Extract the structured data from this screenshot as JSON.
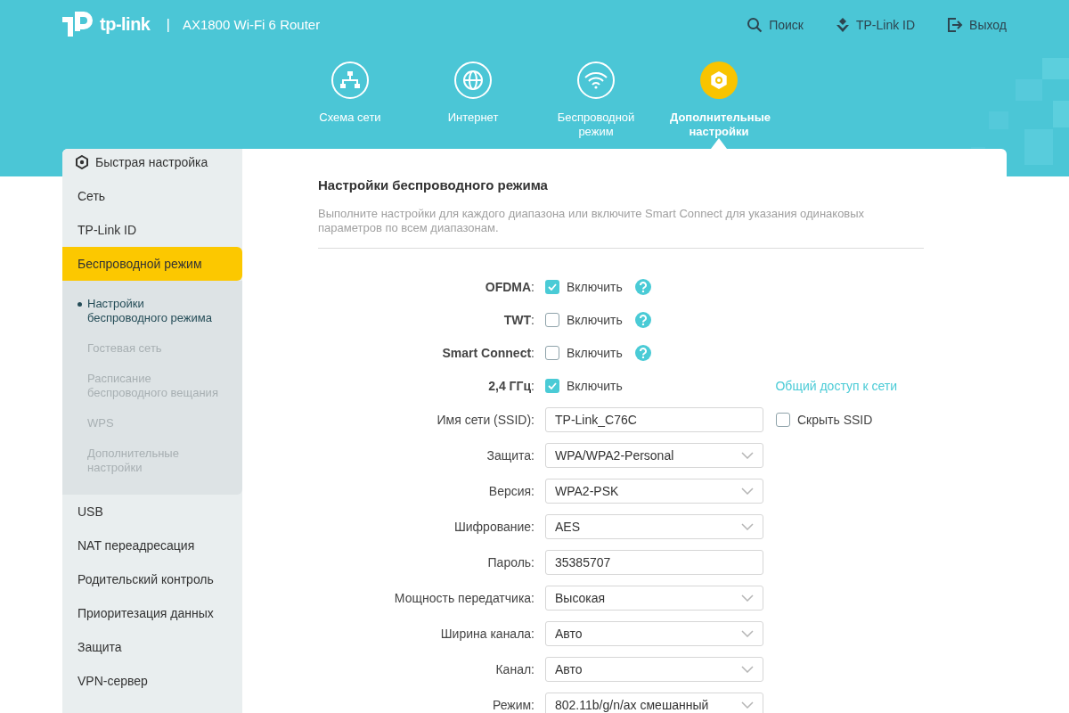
{
  "header": {
    "brand": "tp-link",
    "model": "AX1800 Wi-Fi 6 Router",
    "separator": "|",
    "actions": [
      {
        "label": "Поиск"
      },
      {
        "label": "TP-Link ID"
      },
      {
        "label": "Выход"
      }
    ]
  },
  "nav_tabs": [
    {
      "label": "Схема сети",
      "selected": false
    },
    {
      "label": "Интернет",
      "selected": false
    },
    {
      "label": "Беспроводной режим",
      "selected": false
    },
    {
      "label": "Дополнительные настройки",
      "selected": true
    }
  ],
  "sidebar": {
    "items": [
      {
        "label": "Быстрая настройка",
        "selected": false
      },
      {
        "label": "Сеть",
        "selected": false
      },
      {
        "label": "TP-Link ID",
        "selected": false
      },
      {
        "label": "Беспроводной режим",
        "selected": true,
        "expanded": true,
        "children": [
          {
            "label": "Настройки беспроводного режима",
            "selected": true
          },
          {
            "label": "Гостевая сеть",
            "selected": false
          },
          {
            "label": "Расписание беспроводного вещания",
            "selected": false
          },
          {
            "label": "WPS",
            "selected": false
          },
          {
            "label": "Дополнительные настройки",
            "selected": false
          }
        ]
      },
      {
        "label": "USB",
        "selected": false
      },
      {
        "label": "NAT переадресация",
        "selected": false
      },
      {
        "label": "Родительский контроль",
        "selected": false
      },
      {
        "label": "Приоритезация данных",
        "selected": false
      },
      {
        "label": "Защита",
        "selected": false
      },
      {
        "label": "VPN-сервер",
        "selected": false
      }
    ]
  },
  "content": {
    "title": "Настройки беспроводного режима",
    "description": "Выполните настройки для каждого диапазона или включите Smart Connect для указания одинаковых параметров по всем диапазонам.",
    "rows": [
      {
        "kind": "checkbox",
        "label": "**OFDMA**:",
        "checked": true,
        "option": "Включить",
        "help": true
      },
      {
        "kind": "checkbox",
        "label": "**TWT**:",
        "checked": false,
        "option": "Включить",
        "help": true
      },
      {
        "kind": "checkbox",
        "label": "**Smart Connect**:",
        "checked": false,
        "option": "Включить",
        "help": true
      },
      {
        "kind": "checkbox",
        "label": "**2,4 ГГц**:",
        "checked": true,
        "option": "Включить",
        "help": false,
        "link": "Общий доступ к сети"
      },
      {
        "kind": "text",
        "label": "Имя сети (SSID):",
        "value": "TP-Link_C76C",
        "extra": {
          "label": "Скрыть SSID",
          "checked": false
        }
      },
      {
        "kind": "select",
        "label": "Защита:",
        "value": "WPA/WPA2-Personal"
      },
      {
        "kind": "select",
        "label": "Версия:",
        "value": "WPA2-PSK"
      },
      {
        "kind": "select",
        "label": "Шифрование:",
        "value": "AES"
      },
      {
        "kind": "text",
        "label": "Пароль:",
        "value": "35385707"
      },
      {
        "kind": "select",
        "label": "Мощность передатчика:",
        "value": "Высокая"
      },
      {
        "kind": "select",
        "label": "Ширина канала:",
        "value": "Авто"
      },
      {
        "kind": "select",
        "label": "Канал:",
        "value": "Авто"
      },
      {
        "kind": "select",
        "label": "Режим:",
        "value": "802.11b/g/n/ax смешанный"
      }
    ]
  }
}
